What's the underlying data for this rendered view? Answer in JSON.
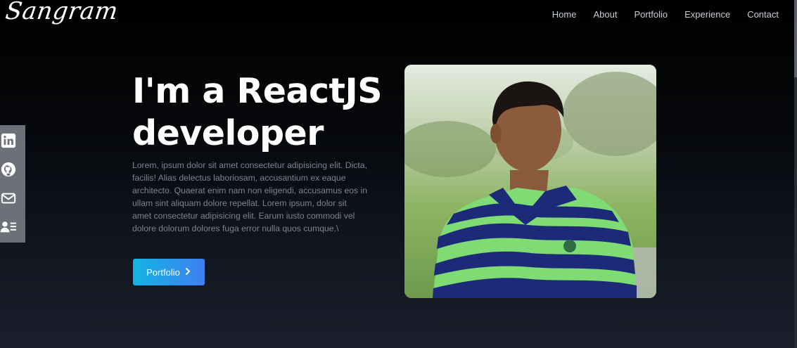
{
  "header": {
    "logo": "Sangram",
    "nav": [
      "Home",
      "About",
      "Portfolio",
      "Experience",
      "Contact"
    ]
  },
  "social": {
    "icons": [
      "linkedin-icon",
      "github-icon",
      "mail-icon",
      "resume-icon"
    ]
  },
  "hero": {
    "headline_line1": "I'm a ReactJS",
    "headline_line2": "developer",
    "description": "Lorem, ipsum dolor sit amet consectetur adipisicing elit. Dicta, facilis! Alias delectus laboriosam, accusantium ex eaque architecto. Quaerat enim nam non eligendi, accusamus eos in ullam sint aliquam dolore repellat. Lorem ipsum, dolor sit amet consectetur adipisicing elit. Earum iusto commodi vel dolore dolorum dolores fuga error nulla quos cumque.\\",
    "cta_label": "Portfolio",
    "cta_icon": "chevron-right-icon"
  },
  "colors": {
    "accent_start": "#14b4e4",
    "accent_end": "#3f7ff0",
    "social_bar": "#6b7079"
  }
}
